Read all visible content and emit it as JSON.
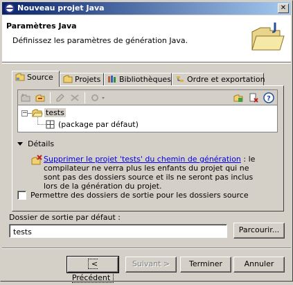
{
  "window": {
    "title": "Nouveau projet Java",
    "close_label": "✕"
  },
  "header": {
    "title": "Paramètres Java",
    "description": "Définissez les paramètres de génération Java."
  },
  "tabs": [
    {
      "label": "Source",
      "icon": "source-folder-icon",
      "active": true
    },
    {
      "label": "Projets",
      "icon": "folder-icon",
      "active": false
    },
    {
      "label": "Bibliothèques",
      "icon": "library-icon",
      "active": false
    },
    {
      "label": "Ordre et exportation",
      "icon": "order-export-icon",
      "active": false
    }
  ],
  "tree": {
    "root_label": "tests",
    "child_label": "(package par défaut)"
  },
  "details": {
    "label": "Détails",
    "link_text": "Supprimer le projet 'tests' du chemin de génération",
    "text_rest": " : le compilateur ne verra plus les enfants du projet qui ne sont pas des dossiers source et ils ne seront pas inclus lors de la génération du projet."
  },
  "checkbox": {
    "label": "Permettre des dossiers de sortie pour les dossiers source",
    "checked": false
  },
  "output": {
    "label": "Dossier de sortie par défaut :",
    "value": "tests",
    "browse_label": "Parcourir..."
  },
  "buttons": {
    "back": "< Précédent",
    "next": "Suivant >",
    "finish": "Terminer",
    "cancel": "Annuler"
  },
  "colors": {
    "title_start": "#0a246a",
    "title_end": "#a6caf0",
    "dialog_bg": "#d4d0c8",
    "link": "#0000ee"
  }
}
